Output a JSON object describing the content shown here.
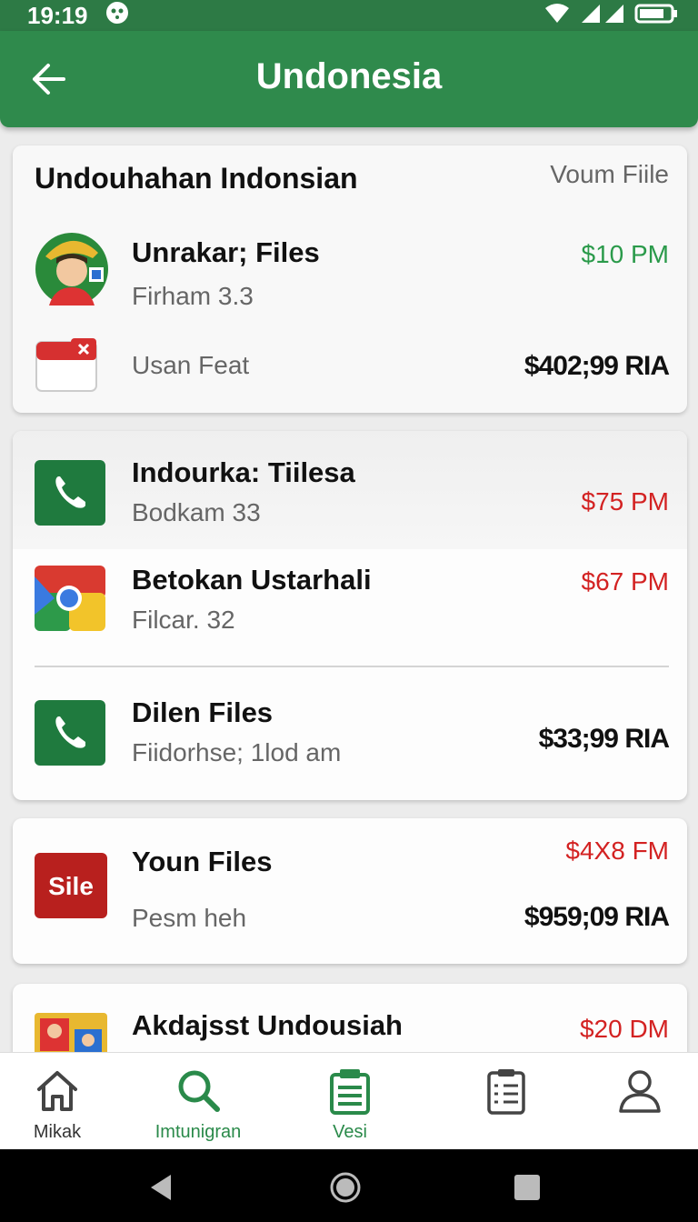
{
  "status_bar": {
    "time": "19:19"
  },
  "app_bar": {
    "title": "Undonesia"
  },
  "card1": {
    "title": "Undouhahan Indonsian",
    "link": "Voum Fiile",
    "rows": [
      {
        "title": "Unrakar; Files",
        "subtitle": "Firham 3.3",
        "value": "$10 PM",
        "icon": "avatar-icon"
      },
      {
        "title": "",
        "subtitle": "Usan Feat",
        "value": "$402;99 RIA",
        "icon": "mail-icon"
      }
    ]
  },
  "card2": {
    "rows": [
      {
        "title": "Indourka: Tiilesa",
        "subtitle": "Bodkam 33",
        "value": "$75 PM",
        "icon": "phone-icon"
      },
      {
        "title": "Betokan Ustarhali",
        "subtitle": "Filcar. 32",
        "value": "$67 PM",
        "icon": "chrome-icon"
      },
      {
        "title": "Dilen Files",
        "subtitle": "Fiidorhse; 1lod am",
        "value": "$33;99 RIA",
        "icon": "phone-icon"
      }
    ]
  },
  "card3": {
    "title": "Youn Files",
    "subtitle": "Pesm heh",
    "value_top": "$4X8 FM",
    "value_bottom": "$959;09 RIA",
    "icon_text": "Sile"
  },
  "card4": {
    "title": "Akdajsst Undousiah",
    "value": "$20 DM"
  },
  "bottom_nav": [
    {
      "label": "Mikak",
      "icon": "home-icon",
      "active": false
    },
    {
      "label": "Imtunigran",
      "icon": "search-icon",
      "active": true
    },
    {
      "label": "Vesi",
      "icon": "document-icon",
      "active": true
    },
    {
      "label": "",
      "icon": "clipboard-icon",
      "active": false
    },
    {
      "label": "",
      "icon": "profile-icon",
      "active": false
    }
  ],
  "colors": {
    "primary": "#2f8a4c",
    "accent_green": "#2a9a4a",
    "accent_red": "#d32222"
  }
}
